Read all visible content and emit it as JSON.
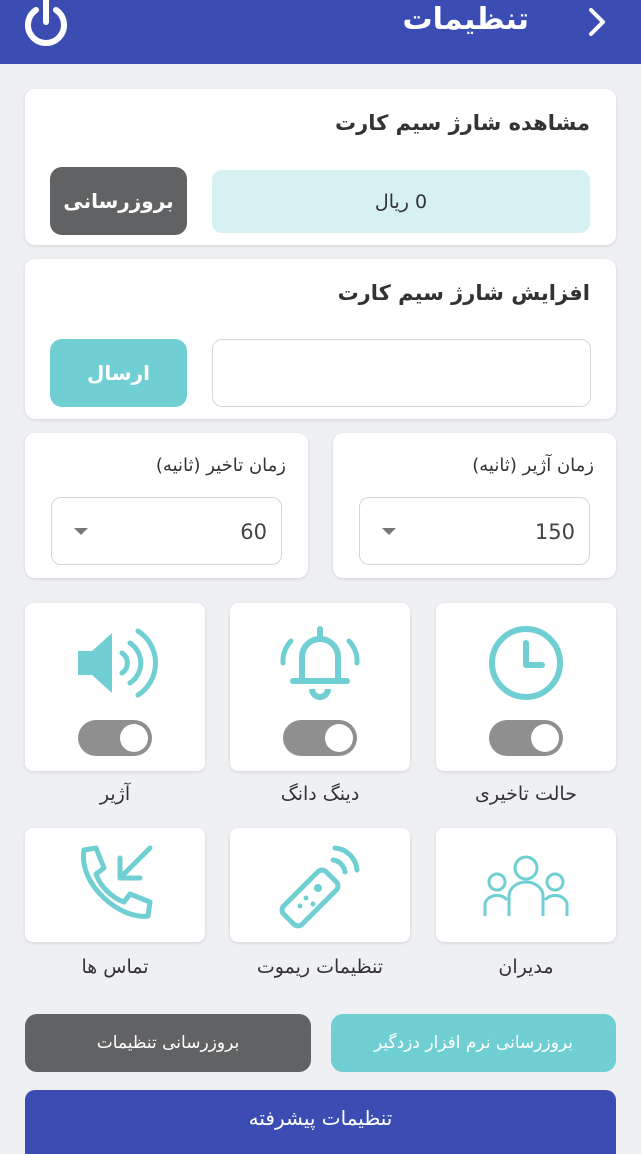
{
  "header": {
    "title": "تنظیمات",
    "back_icon": "chevron-right-icon",
    "power_icon": "power-icon"
  },
  "sim_balance": {
    "title": "مشاهده شارژ سیم کارت",
    "value": "0 ریال",
    "refresh_label": "بروزرسانی"
  },
  "sim_topup": {
    "title": "افزایش شارژ سیم کارت",
    "input_value": "",
    "send_label": "ارسال"
  },
  "timers": {
    "siren": {
      "label": "زمان آژیر (ثانیه)",
      "value": "150"
    },
    "delay": {
      "label": "زمان تاخیر (ثانیه)",
      "value": "60"
    }
  },
  "toggles": [
    {
      "label": "حالت تاخیری",
      "icon": "clock-icon",
      "on": true
    },
    {
      "label": "دینگ دانگ",
      "icon": "bell-icon",
      "on": true
    },
    {
      "label": "آژیر",
      "icon": "speaker-icon",
      "on": true
    }
  ],
  "shortcuts": [
    {
      "label": "مدیران",
      "icon": "users-icon"
    },
    {
      "label": "تنظیمات ریموت",
      "icon": "remote-icon"
    },
    {
      "label": "تماس ها",
      "icon": "incoming-call-icon"
    }
  ],
  "actions": {
    "firmware_update": "بروزرسانی نرم افزار دزدگیر",
    "settings_update": "بروزرسانی تنظیمات",
    "advanced": "تنظیمات پیشرفته"
  },
  "colors": {
    "primary": "#3b4db3",
    "teal": "#6fcfd3",
    "dark_button": "#616263",
    "toggle_track": "#8f8f8f"
  }
}
